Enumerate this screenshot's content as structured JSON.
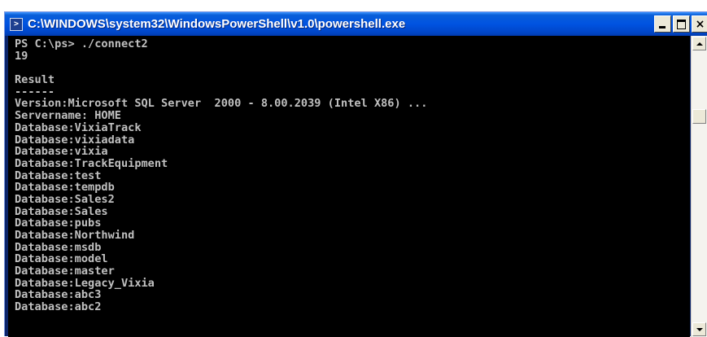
{
  "window": {
    "title": "C:\\WINDOWS\\system32\\WindowsPowerShell\\v1.0\\powershell.exe",
    "icon": "powershell-icon",
    "buttons": {
      "minimize": "minimize-icon",
      "maximize": "maximize-icon",
      "close": "close-icon"
    },
    "close_glyph": "×"
  },
  "console": {
    "lines": [
      "PS C:\\ps> ./connect2",
      "19",
      "",
      "Result",
      "------",
      "Version:Microsoft SQL Server  2000 - 8.00.2039 (Intel X86) ...",
      "Servername: HOME",
      "Database:VixiaTrack",
      "Database:vixiadata",
      "Database:vixia",
      "Database:TrackEquipment",
      "Database:test",
      "Database:tempdb",
      "Database:Sales2",
      "Database:Sales",
      "Database:pubs",
      "Database:Northwind",
      "Database:msdb",
      "Database:model",
      "Database:master",
      "Database:Legacy_Vixia",
      "Database:abc3",
      "Database:abc2"
    ]
  },
  "colors": {
    "titlebar": "#0053e1",
    "console_bg": "#000000",
    "console_text": "#c0c0c0"
  }
}
